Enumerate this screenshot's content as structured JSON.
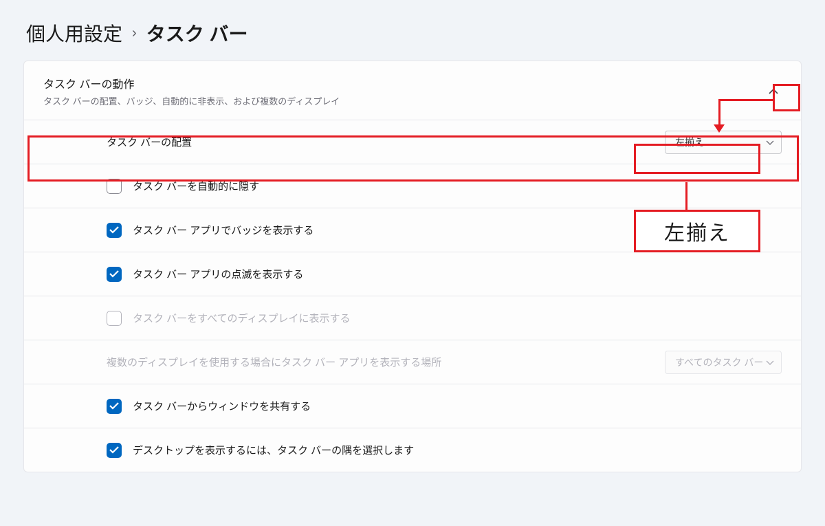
{
  "breadcrumb": {
    "parent": "個人用設定",
    "sep": "›",
    "current": "タスク バー"
  },
  "group": {
    "title": "タスク バーの動作",
    "subtitle": "タスク バーの配置、バッジ、自動的に非表示、および複数のディスプレイ"
  },
  "alignment": {
    "label": "タスク バーの配置",
    "selected": "左揃え"
  },
  "autohide": {
    "label": "タスク バーを自動的に隠す"
  },
  "badges": {
    "label": "タスク バー アプリでバッジを表示する"
  },
  "flashing": {
    "label": "タスク バー アプリの点滅を表示する"
  },
  "alldisplays": {
    "label": "タスク バーをすべてのディスプレイに表示する"
  },
  "multimon": {
    "label": "複数のディスプレイを使用する場合にタスク バー アプリを表示する場所",
    "selected": "すべてのタスク バー"
  },
  "sharewin": {
    "label": "タスク バーからウィンドウを共有する"
  },
  "showdesk": {
    "label": "デスクトップを表示するには、タスク バーの隅を選択します"
  },
  "callout": "左揃え"
}
